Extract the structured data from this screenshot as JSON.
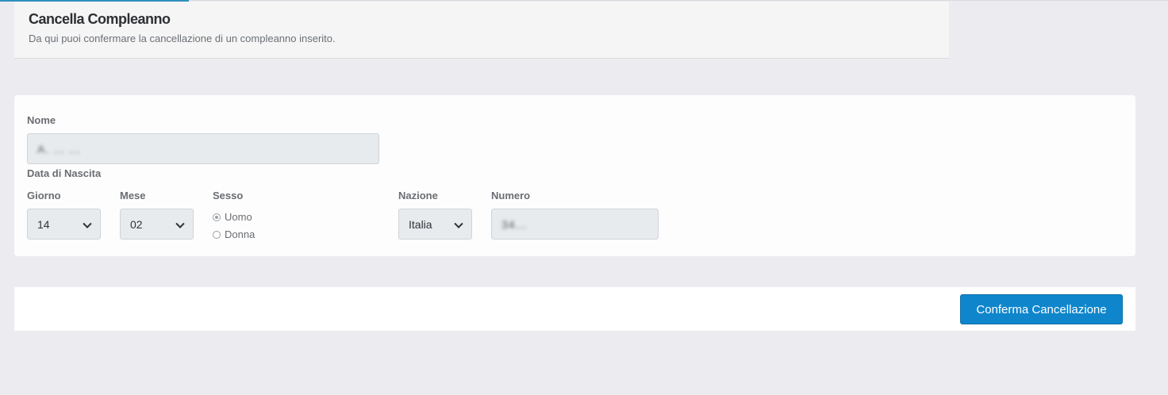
{
  "header": {
    "title": "Cancella Compleanno",
    "subtitle": "Da qui puoi confermare la cancellazione di un compleanno inserito."
  },
  "form": {
    "nome_label": "Nome",
    "nome_value": "A. ... ...",
    "data_label": "Data di Nascita",
    "giorno_label": "Giorno",
    "giorno_value": "14",
    "mese_label": "Mese",
    "mese_value": "02",
    "sesso_label": "Sesso",
    "sesso_options": [
      "Uomo",
      "Donna"
    ],
    "sesso_selected": "Uomo",
    "nazione_label": "Nazione",
    "nazione_value": "Italia",
    "numero_label": "Numero",
    "numero_value": "34..."
  },
  "footer": {
    "confirm_button": "Conferma Cancellazione"
  },
  "colors": {
    "accent": "#0f86cc",
    "background": "#ececf0"
  }
}
